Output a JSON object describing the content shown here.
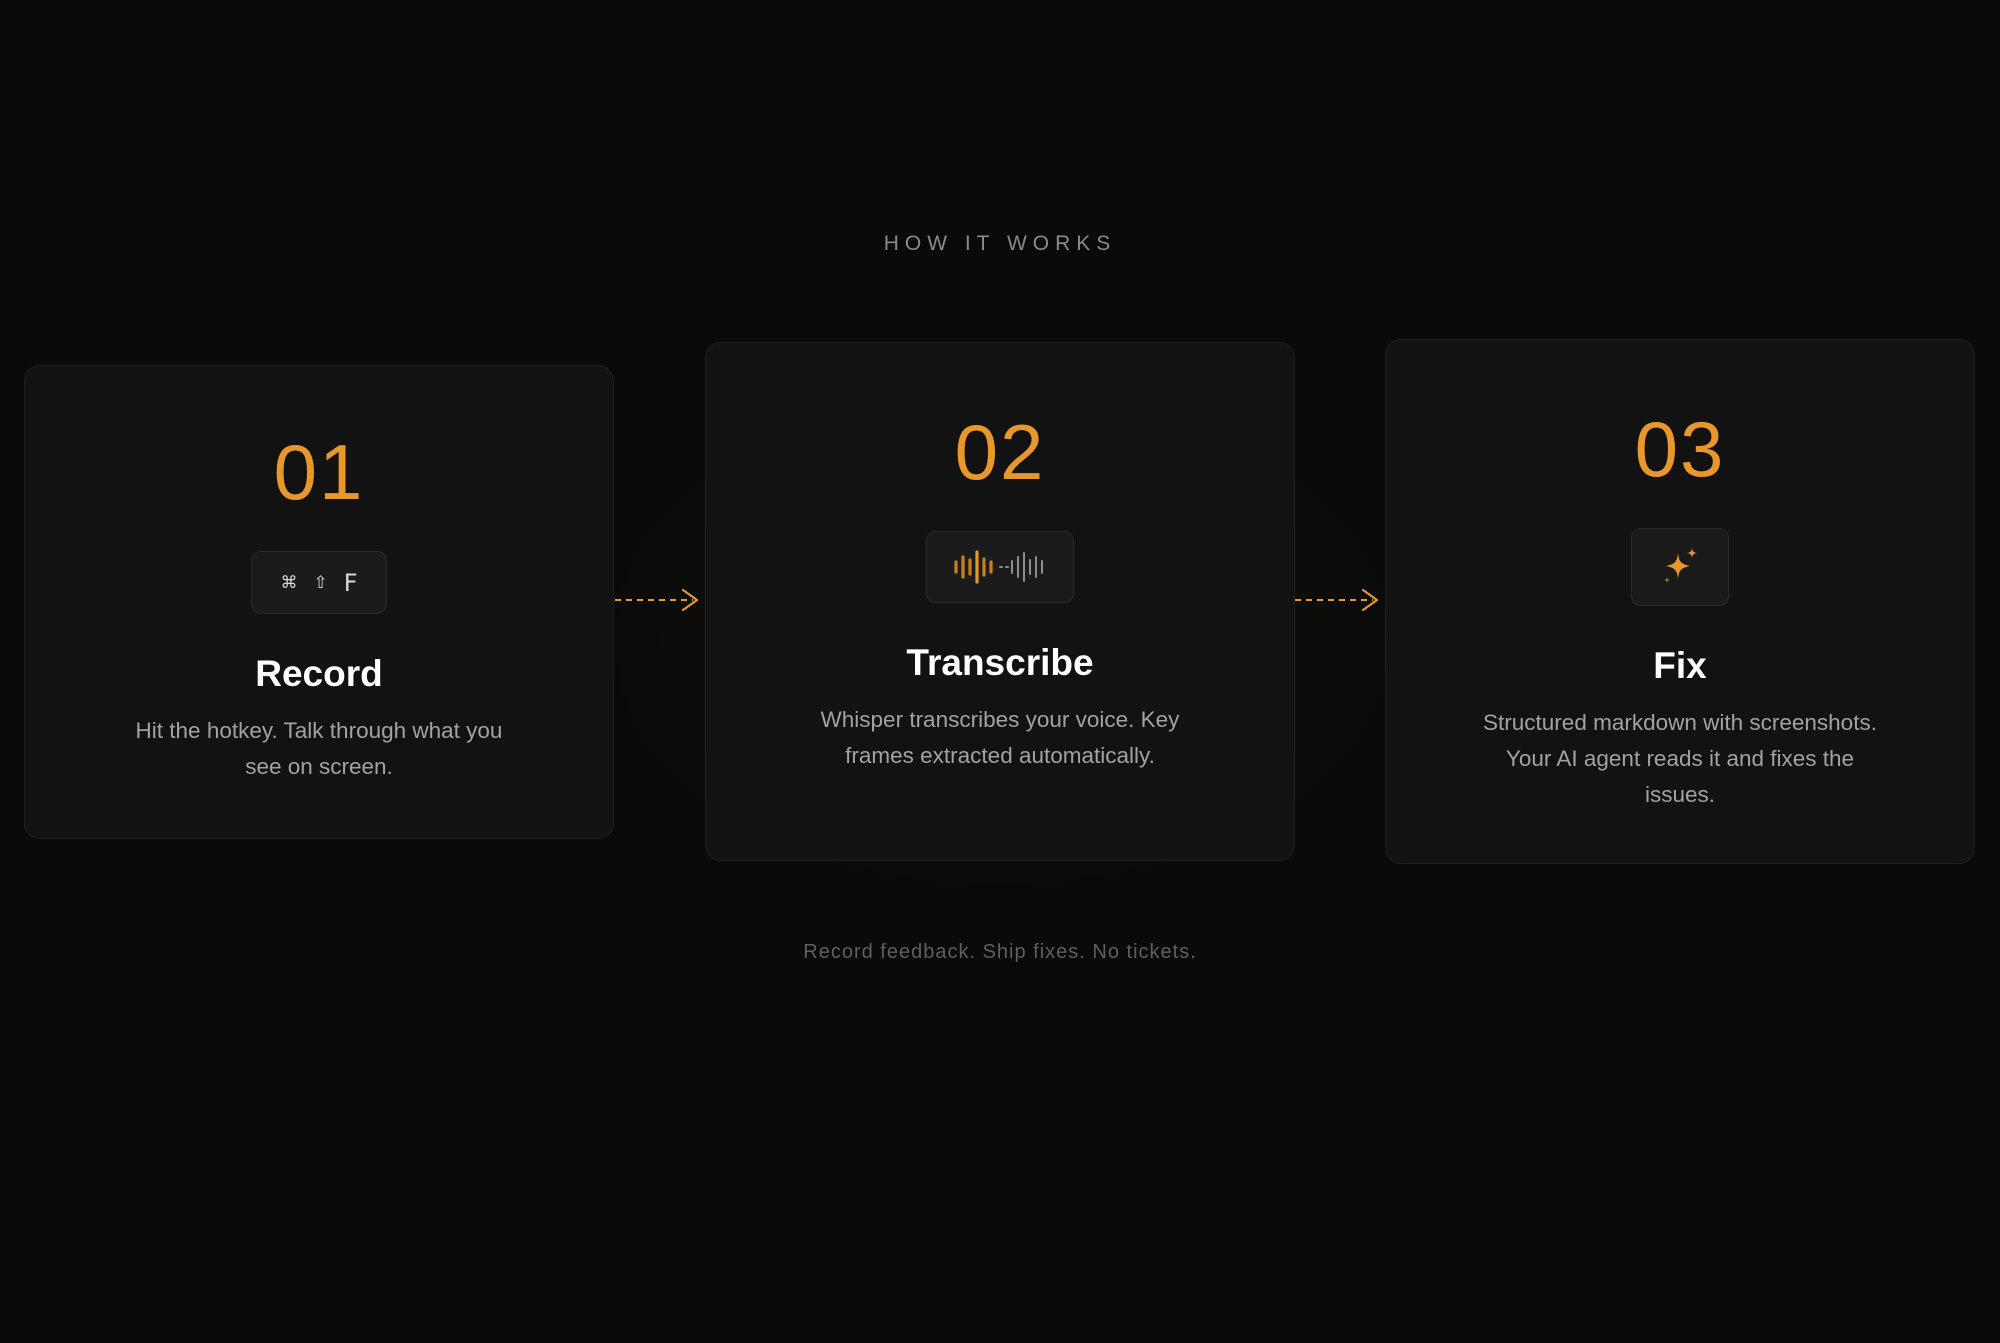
{
  "section": {
    "label": "HOW IT WORKS"
  },
  "steps": [
    {
      "number": "01",
      "title": "Record",
      "description": "Hit the hotkey. Talk through what you see on screen.",
      "icon": "keyboard-shortcut",
      "keys": [
        "⌘",
        "⇧",
        "F"
      ]
    },
    {
      "number": "02",
      "title": "Transcribe",
      "description": "Whisper transcribes your voice. Key frames extracted automatically.",
      "icon": "waveform-icon"
    },
    {
      "number": "03",
      "title": "Fix",
      "description": "Structured markdown with screenshots. Your AI agent reads it and fixes the issues.",
      "icon": "sparkle-icon"
    }
  ],
  "tagline": "Record feedback. Ship fixes. No tickets.",
  "colors": {
    "background": "#0a0a0a",
    "card": "#121212",
    "accent": "#e8972b",
    "muted": "#8a8a8a"
  }
}
